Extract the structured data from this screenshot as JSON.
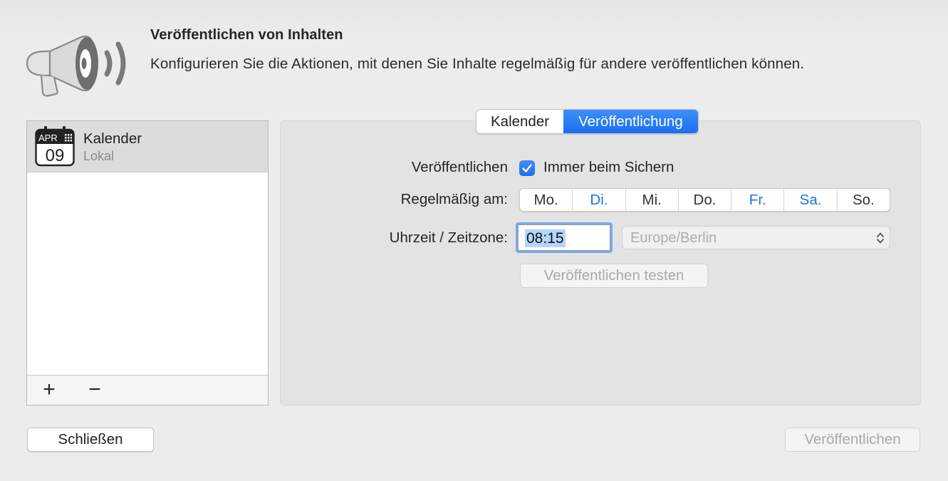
{
  "header": {
    "title": "Veröffentlichen von Inhalten",
    "description": "Konfigurieren Sie die Aktionen, mit denen Sie Inhalte regelmäßig für andere veröffentlichen können.",
    "icon": "megaphone-icon"
  },
  "sidebar": {
    "items": [
      {
        "name": "Kalender",
        "subtitle": "Lokal",
        "icon_month": "APR",
        "icon_day": "09",
        "selected": true
      }
    ],
    "add_label": "+",
    "remove_label": "−"
  },
  "tabs": [
    {
      "label": "Kalender",
      "active": false
    },
    {
      "label": "Veröffentlichung",
      "active": true
    }
  ],
  "form": {
    "publish_label": "Veröffentlichen",
    "always_on_save_label": "Immer beim Sichern",
    "always_on_save_checked": true,
    "regular_label": "Regelmäßig am:",
    "days": [
      {
        "label": "Mo.",
        "selected": false
      },
      {
        "label": "Di.",
        "selected": true
      },
      {
        "label": "Mi.",
        "selected": false
      },
      {
        "label": "Do.",
        "selected": false
      },
      {
        "label": "Fr.",
        "selected": true
      },
      {
        "label": "Sa.",
        "selected": true
      },
      {
        "label": "So.",
        "selected": false
      }
    ],
    "time_label": "Uhrzeit / Zeitzone:",
    "time_value": "08:15",
    "timezone_value": "Europe/Berlin",
    "test_button": "Veröffentlichen testen"
  },
  "footer": {
    "close_button": "Schließen",
    "publish_button": "Veröffentlichen"
  },
  "colors": {
    "accent": "#1b6ff2",
    "selected_day": "#1a73e8",
    "disabled_text": "#a9a9a9"
  }
}
